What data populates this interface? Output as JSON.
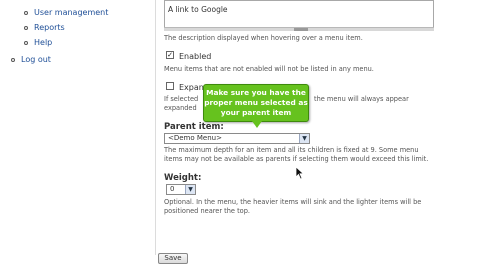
{
  "sidebar": {
    "items": [
      {
        "label": "User management"
      },
      {
        "label": "Reports"
      },
      {
        "label": "Help"
      },
      {
        "label": "Log out"
      }
    ]
  },
  "form": {
    "description_value": "A link to Google",
    "description_help": "The description displayed when hovering over a menu item.",
    "enabled_label": "Enabled",
    "enabled_checked": true,
    "enabled_help": "Menu items that are not enabled will not be listed in any menu.",
    "expanded_label": "Expan",
    "expanded_checked": false,
    "expanded_help_start": "If selected",
    "expanded_help_end": "the menu will always appear",
    "expanded_help_line2": "expanded",
    "parent_label": "Parent item:",
    "parent_value": "<Demo Menu>",
    "parent_help_line1": "The maximum depth for an item and all its children is fixed at 9. Some menu",
    "parent_help_line2": "items may not be available as parents if selecting them would exceed this limit.",
    "weight_label": "Weight:",
    "weight_value": "0",
    "weight_help_line1": "Optional. In the menu, the heavier items will sink and the lighter items will be",
    "weight_help_line2": "positioned nearer the top.",
    "save_label": "Save"
  },
  "callout": {
    "line1": "Make sure you have the",
    "line2": "proper menu selected as",
    "line3": "your parent item",
    "color": "#66c21e"
  },
  "icons": {
    "cursor": "mouse-pointer-icon",
    "select_arrow": "chevron-down-icon"
  }
}
